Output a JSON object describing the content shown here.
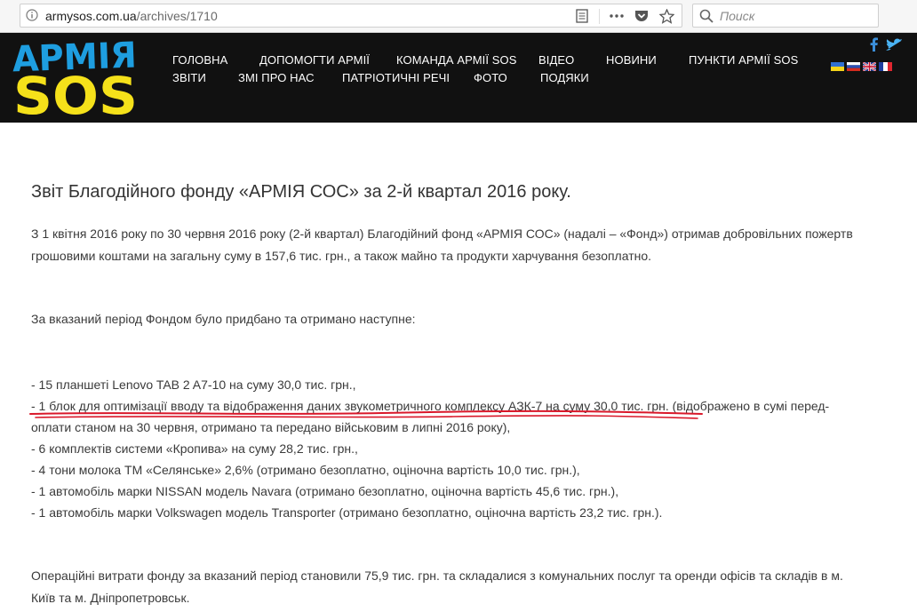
{
  "browser": {
    "url_host": "armysos.com.ua",
    "url_path": "/archives/1710",
    "search_placeholder": "Поиск"
  },
  "header": {
    "logo_top": "АРМІЯ",
    "logo_bottom": "SOS",
    "nav_row1": [
      "ГОЛОВНА",
      "ДОПОМОГТИ АРМІЇ",
      "КОМАНДА АРМІЇ SOS",
      "ВІДЕО",
      "НОВИНИ",
      "ПУНКТИ АРМІЇ SOS"
    ],
    "nav_row2": [
      "ЗВІТИ",
      "ЗМІ ПРО НАС",
      "ПАТРІОТИЧНІ РЕЧІ",
      "ФОТО",
      "ПОДЯКИ"
    ],
    "colors": {
      "background": "#111111",
      "logo_blue": "#1e9ee0",
      "logo_yellow": "#f5e11a",
      "facebook": "#3b8ed8",
      "twitter": "#4ab3f4"
    }
  },
  "article": {
    "title": "Звіт Благодійного фонду «АРМІЯ СОС» за 2-й квартал 2016 року.",
    "intro_line1": "З 1 квітня 2016 року по 30 червня 2016 року (2-й квартал) Благодійний фонд «АРМІЯ СОС» (надалі – «Фонд») отримав добровільних пожертв",
    "intro_line2": "грошовими коштами на загальну суму в 157,6 тис. грн., а також майно та продукти харчування безоплатно.",
    "period_intro": "За вказаний період Фондом було придбано та отримано наступне:",
    "items": [
      "- 15 планшеті Lenovo TAB 2 A7-10 на суму 30,0 тис. грн.,",
      "- 1 блок для оптимізації вводу та відображення даних звукометричного комплексу АЗК-7 на суму 30,0 тис. грн. (відображено в сумі перед-",
      "оплати станом на 30 червня, отримано та передано військовим в липні 2016 року),",
      "- 6 комплектів системи «Кропива» на суму 28,2 тис. грн.,",
      "- 4 тони молока ТМ «Селянське» 2,6% (отримано безоплатно, оціночна вартість 10,0 тис. грн.),",
      "- 1 автомобіль марки NISSAN модель Navara (отримано безоплатно, оціночна вартість 45,6 тис. грн.),",
      "- 1 автомобіль марки Volkswagen модель Transporter (отримано безоплатно, оціночна вартість 23,2 тис. грн.)."
    ],
    "expenses_line1": "Операційні витрати фонду за вказаний період становили 75,9 тис. грн. та складалися з комунальних послуг та оренди офісів та складів в м.",
    "expenses_line2": "Київ та м. Дніпропетровськ."
  }
}
